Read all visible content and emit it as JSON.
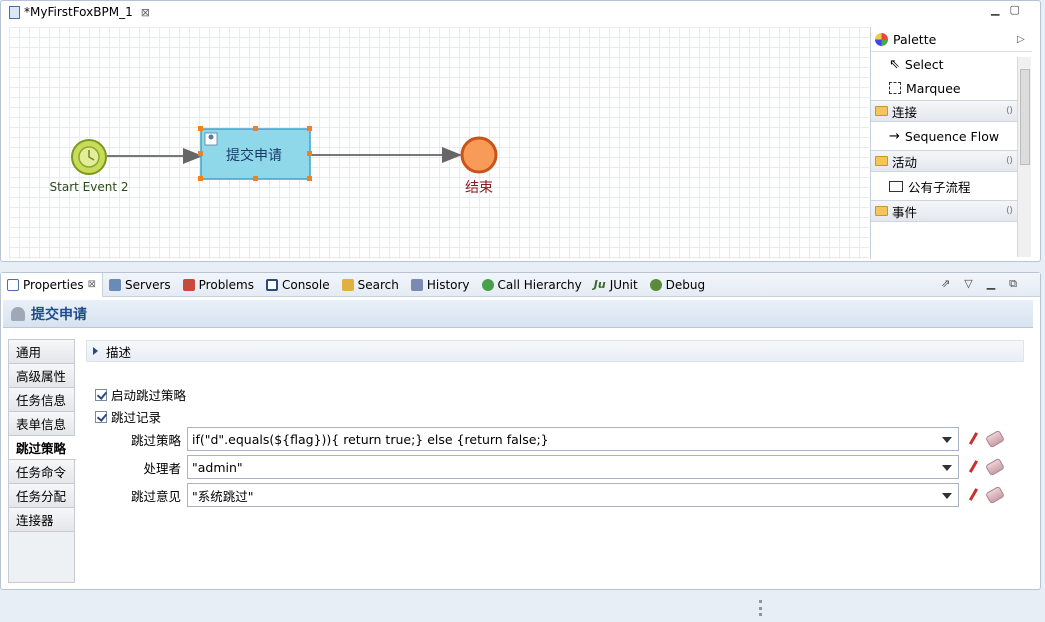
{
  "editor": {
    "tab_title": "*MyFirstFoxBPM_1",
    "close": "⊠"
  },
  "diagram": {
    "start_label": "Start Event 2",
    "task_label": "提交申请",
    "end_label": "结束"
  },
  "palette": {
    "title": "Palette",
    "tools": [
      "Select",
      "Marquee"
    ],
    "drawers": [
      {
        "label": "连接",
        "items": [
          "Sequence Flow"
        ]
      },
      {
        "label": "活动",
        "items": [
          "公有子流程"
        ]
      },
      {
        "label": "事件",
        "items": []
      }
    ]
  },
  "views": {
    "tabs": [
      "Properties",
      "Servers",
      "Problems",
      "Console",
      "Search",
      "History",
      "Call Hierarchy",
      "JUnit",
      "Debug"
    ]
  },
  "properties": {
    "title": "提交申请",
    "sidebar": [
      "通用",
      "高级属性",
      "任务信息",
      "表单信息",
      "跳过策略",
      "任务命令",
      "任务分配",
      "连接器"
    ],
    "active_tab": "跳过策略",
    "section": "描述",
    "checkboxes": [
      "启动跳过策略",
      "跳过记录"
    ],
    "fields": [
      {
        "label": "跳过策略",
        "value": "if(\"d\".equals(${flag})){ return true;} else {return false;}"
      },
      {
        "label": "处理者",
        "value": "\"admin\""
      },
      {
        "label": "跳过意见",
        "value": "\"系统跳过\""
      }
    ]
  }
}
